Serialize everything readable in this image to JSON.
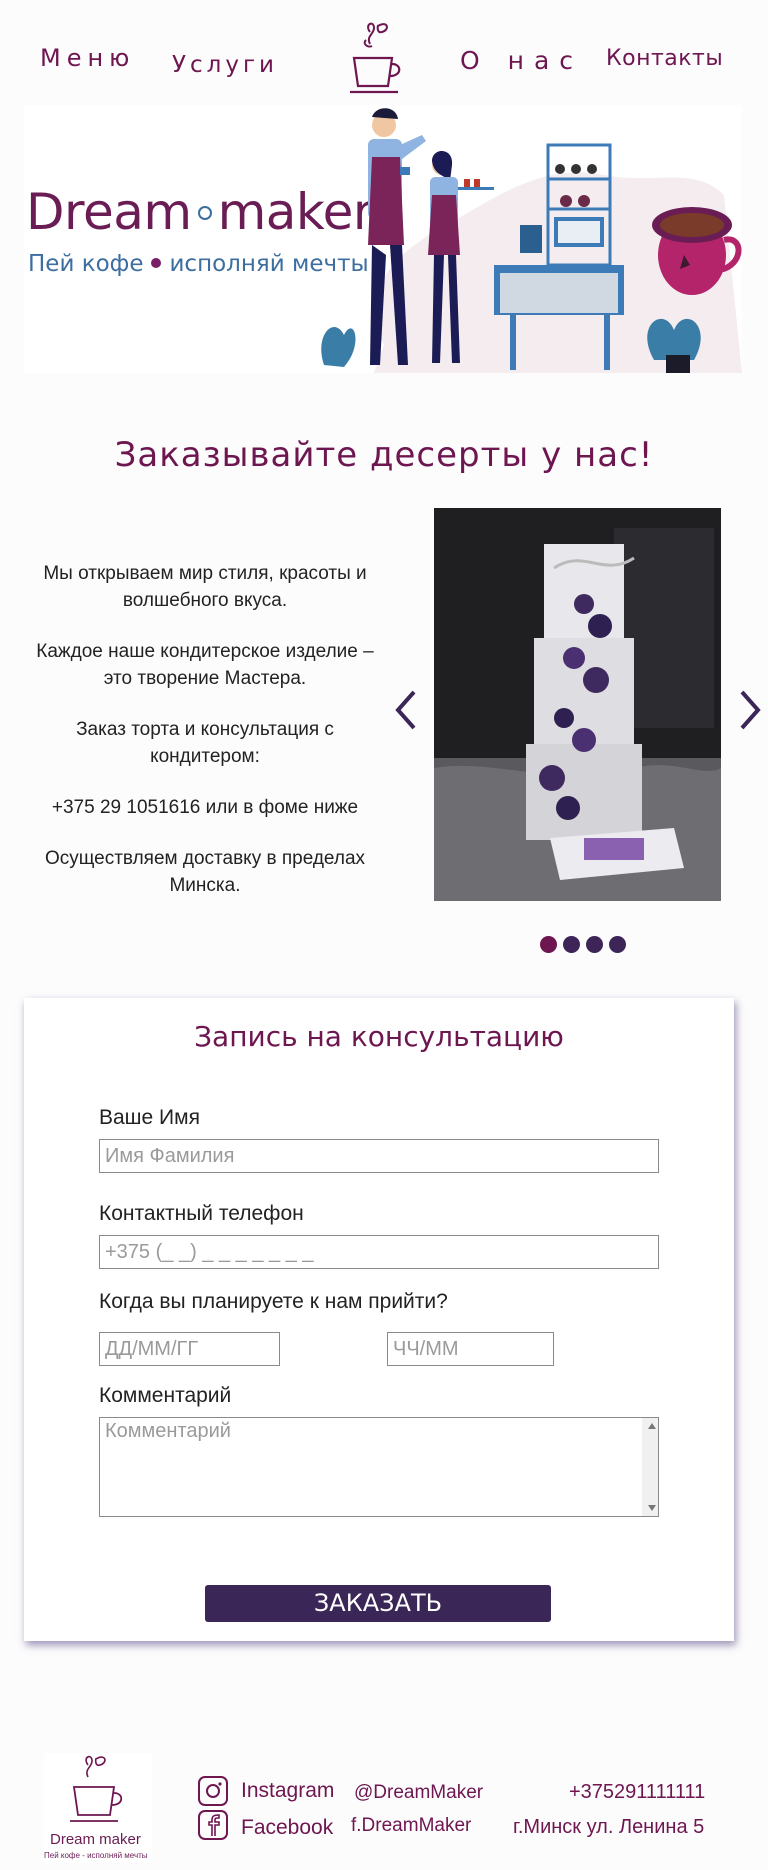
{
  "nav": {
    "menu": "Меню",
    "services": "Услуги",
    "about": "О нас",
    "contacts": "Контакты"
  },
  "hero": {
    "brand_left": "Dream",
    "brand_right": "maker",
    "tagline_left": "Пей кофе",
    "tagline_right": "исполняй мечты"
  },
  "desserts": {
    "title": "Заказывайте десерты у нас!",
    "paragraphs": [
      "Мы открываем мир стиля, красоты и волшебного вкуса.",
      "Каждое наше кондитерское изделие – это творение Мастера.",
      "Заказ торта и консультация с кондитером:",
      "+375 29 1051616 или в фоме ниже",
      "Осуществляем доставку в пределах Минска."
    ],
    "carousel": {
      "slides_count": 4,
      "active_index": 0
    }
  },
  "form": {
    "title": "Запись на консультацию",
    "name_label": "Ваше Имя",
    "name_placeholder": "Имя Фамилия",
    "phone_label": "Контактный телефон",
    "phone_placeholder": "+375 (_ _) _ _ _ _ _ _ _",
    "visit_label": "Когда вы планируете к нам прийти?",
    "date_placeholder": "ДД/ММ/ГГ",
    "time_placeholder": "ЧЧ/ММ",
    "comment_label": "Комментарий",
    "comment_placeholder": "Комментарий",
    "submit": "ЗАКАЗАТЬ"
  },
  "footer": {
    "brand": "Dream  maker",
    "tagline": "Пей кофе - исполняй мечты",
    "instagram_label": "Instagram",
    "instagram_handle": "@DreamMaker",
    "facebook_label": "Facebook",
    "facebook_handle": "f.DreamMaker",
    "phone": "+375291111111",
    "address": "г.Минск ул. Ленина 5"
  },
  "colors": {
    "accent": "#6d1650",
    "button": "#3b2658",
    "blue": "#3c6ea0"
  }
}
